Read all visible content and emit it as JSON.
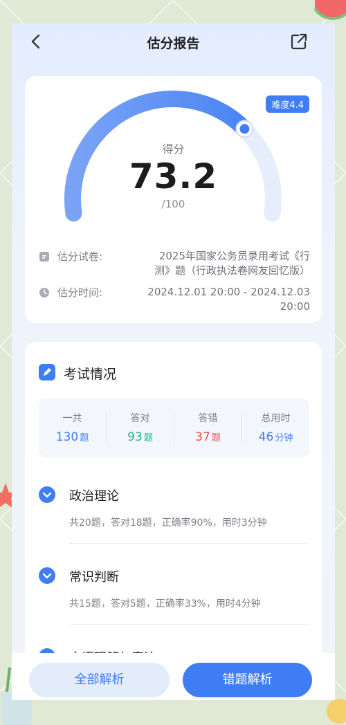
{
  "nav": {
    "title": "估分报告",
    "back_icon": "chevron-left-icon",
    "share_icon": "share-icon"
  },
  "report": {
    "difficulty": "难度4.4",
    "score_label": "得分",
    "score": "73.2",
    "score_total": "/100",
    "score_fraction": 0.732,
    "paper_label": "估分试卷:",
    "paper_value": "2025年国家公务员录用考试《行测》题（行政执法卷网友回忆版）",
    "time_label": "估分时间:",
    "time_value": "2024.12.01 20:00 - 2024.12.03 20:00"
  },
  "exam": {
    "title": "考试情况",
    "stats": [
      {
        "key": "一共",
        "value": "130",
        "unit": "题",
        "color": "#3f7df5"
      },
      {
        "key": "答对",
        "value": "93",
        "unit": "题",
        "color": "#22b68a"
      },
      {
        "key": "答错",
        "value": "37",
        "unit": "题",
        "color": "#f0504f"
      },
      {
        "key": "总用时",
        "value": "46",
        "unit": "分钟",
        "color": "#3f7df5"
      }
    ],
    "subjects": [
      {
        "name": "政治理论",
        "detail": "共20题，答对18题，正确率90%，用时3分钟"
      },
      {
        "name": "常识判断",
        "detail": "共15题，答对5题，正确率33%，用时4分钟"
      },
      {
        "name": "言语理解与表达",
        "detail": ""
      }
    ]
  },
  "actions": {
    "all_label": "全部解析",
    "wrong_label": "错题解析"
  },
  "colors": {
    "accent": "#3f7df5",
    "correct": "#22b68a",
    "wrong": "#f0504f"
  }
}
